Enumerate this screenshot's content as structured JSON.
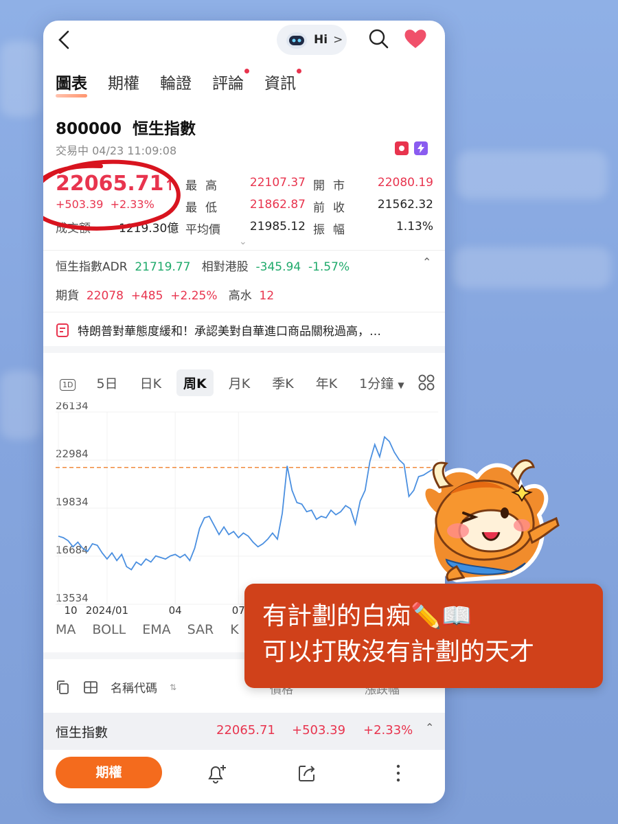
{
  "header": {
    "back_icon": "chevron-left-icon",
    "assistant_label": "Hi",
    "search_icon": "search-icon",
    "favorite_icon": "heart-icon"
  },
  "tabs": [
    {
      "label": "圖表",
      "active": true,
      "dot": false
    },
    {
      "label": "期權",
      "active": false,
      "dot": false
    },
    {
      "label": "輪證",
      "active": false,
      "dot": false
    },
    {
      "label": "評論",
      "active": false,
      "dot": true
    },
    {
      "label": "資訊",
      "active": false,
      "dot": true
    }
  ],
  "quote": {
    "code": "800000",
    "name": "恒生指數",
    "status": "交易中 04/23 11:09:08",
    "price": "22065.71",
    "change": "+503.39",
    "change_pct": "+2.33%",
    "volume_label": "成交額",
    "volume": "1219.30億",
    "stats": [
      {
        "label": "最高",
        "value": "22107.37",
        "color": "red"
      },
      {
        "label": "開市",
        "value": "22080.19",
        "color": "red"
      },
      {
        "label": "最低",
        "value": "21862.87",
        "color": "red"
      },
      {
        "label": "前收",
        "value": "21562.32",
        "color": "dark"
      },
      {
        "label": "平均價",
        "value": "21985.12",
        "color": "dark"
      },
      {
        "label": "振幅",
        "value": "1.13%",
        "color": "dark"
      }
    ]
  },
  "adr": {
    "label": "恒生指數ADR",
    "value": "21719.77",
    "rel_label": "相對港股",
    "rel_change": "-345.94",
    "rel_pct": "-1.57%"
  },
  "futures": {
    "label": "期貨",
    "value": "22078",
    "change": "+485",
    "pct": "+2.25%",
    "premium_label": "高水",
    "premium": "12"
  },
  "news": {
    "text": "特朗普對華態度緩和！承認美對自華進口商品關稅過高，…"
  },
  "chart_tabs": [
    {
      "label": "1D",
      "icon": true
    },
    {
      "label": "5日"
    },
    {
      "label": "日K"
    },
    {
      "label": "周K",
      "active": true
    },
    {
      "label": "月K"
    },
    {
      "label": "季K"
    },
    {
      "label": "年K"
    },
    {
      "label": "1分鐘"
    }
  ],
  "chart_data": {
    "type": "line",
    "ylim": [
      13534,
      26134
    ],
    "yticks": [
      "26134",
      "22984",
      "19834",
      "16684",
      "13534"
    ],
    "xticks": [
      {
        "label": "10",
        "i": 0
      },
      {
        "label": "2024/01",
        "i": 10
      },
      {
        "label": "04",
        "i": 24
      },
      {
        "label": "07",
        "i": 37
      }
    ],
    "reference_line": 22500,
    "series": [
      {
        "values": [
          18000,
          17900,
          17700,
          17300,
          17600,
          17200,
          17000,
          17500,
          17400,
          16900,
          16500,
          16900,
          16400,
          16800,
          16000,
          15800,
          16300,
          16100,
          16500,
          16300,
          16700,
          16600,
          16500,
          16700,
          16800,
          16600,
          16800,
          16400,
          17200,
          18500,
          19200,
          19300,
          18700,
          18100,
          18600,
          18100,
          18300,
          17900,
          18200,
          18000,
          17600,
          17300,
          17500,
          17800,
          18200,
          17800,
          19500,
          22600,
          21000,
          20200,
          20100,
          19600,
          19700,
          19100,
          19300,
          19200,
          19700,
          19400,
          19600,
          20000,
          19800,
          18800,
          20300,
          21000,
          22900,
          24000,
          23200,
          24500,
          24200,
          23500,
          23000,
          22700,
          20600,
          21000,
          21900,
          22000,
          22200,
          22400,
          22065
        ]
      }
    ]
  },
  "indicators": [
    "MA",
    "BOLL",
    "EMA",
    "SAR",
    "K"
  ],
  "list_header": {
    "name_code": "名稱代碼",
    "price": "價格",
    "change": "漲跌幅"
  },
  "index_row": {
    "name": "恒生指數",
    "price": "22065.71",
    "change": "+503.39",
    "pct": "+2.33%"
  },
  "bottom": {
    "options_button": "期權"
  },
  "overlay": {
    "line1": "有計劃的白痴✏️📖",
    "line2": "可以打敗沒有計劃的天才"
  },
  "colors": {
    "up": "#e8344e",
    "down": "#1faa6b",
    "accent": "#f46b1d",
    "line": "#4a8fe0",
    "ref": "#f08a3c"
  }
}
